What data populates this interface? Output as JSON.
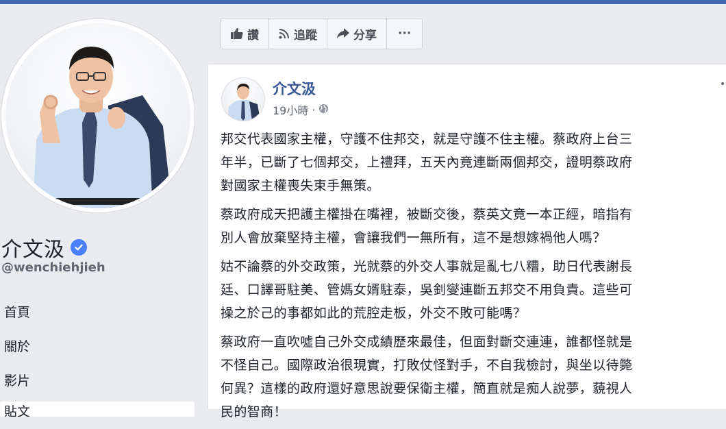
{
  "colors": {
    "brand": "#4267b2",
    "link": "#385898",
    "verified": "#4880ff",
    "background": "#e9ebee"
  },
  "profile": {
    "name": "介文汲",
    "handle": "@wenchiehjieh",
    "verified_icon": "verified-badge-icon"
  },
  "nav": {
    "items": [
      {
        "label": "首頁"
      },
      {
        "label": "關於"
      },
      {
        "label": "影片"
      },
      {
        "label": "貼文"
      }
    ]
  },
  "actions": {
    "like": {
      "label": "讚",
      "icon": "thumbs-up-icon"
    },
    "follow": {
      "label": "追蹤",
      "icon": "rss-icon"
    },
    "share": {
      "label": "分享",
      "icon": "share-arrow-icon"
    },
    "more": {
      "label": "···",
      "icon": "more-icon"
    }
  },
  "post": {
    "author": "介文汲",
    "time": "19小時",
    "time_sep": "·",
    "privacy_icon": "globe-icon",
    "paragraphs": [
      "邦交代表國家主權，守護不住邦交，就是守護不住主權。蔡政府上台三\n年半，已斷了七個邦交，上禮拜，五天內竟連斷兩個邦交，證明蔡政府\n對國家主權喪失束手無策。",
      "蔡政府成天把護主權掛在嘴裡，被斷交後，蔡英文竟一本正經，暗指有\n別人會放棄堅持主權，會讓我們一無所有，這不是想嫁禍他人嗎？",
      "姑不論蔡的外交政策，光就蔡的外交人事就是亂七八糟，助日代表謝長\n廷、口譯哥駐美、管媽女婿駐泰，吳釗燮連斷五邦交不用負責。這些可\n操之於己的事都如此的荒腔走板，外交不敗可能嗎？",
      "蔡政府一直吹噓自己外交成績歷來最佳，但面對斷交連連，誰都怪就是\n不怪自己。國際政治很現實，打敗仗怪對手，不自我檢討，與坐以待斃\n何異？這樣的政府還好意思說要保衛主權，簡直就是痴人說夢，藐視人\n民的智商！"
    ]
  }
}
